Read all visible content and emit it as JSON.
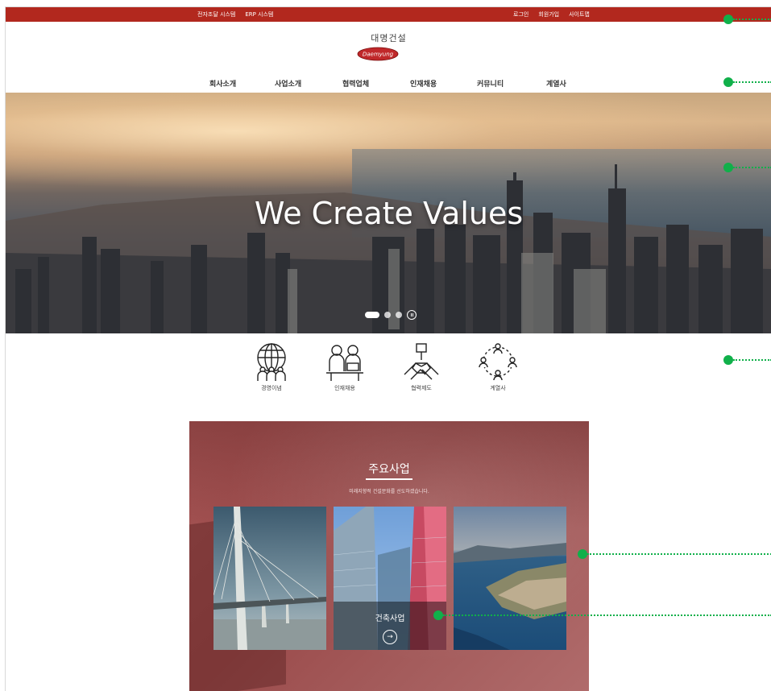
{
  "topbar": {
    "left_links": [
      "전자조달 시스템",
      "ERP 시스템"
    ],
    "right_links": [
      "로그인",
      "회원가입",
      "사이트맵"
    ]
  },
  "header": {
    "brand_name": "대명건설",
    "logo_text": "Daemyung"
  },
  "nav": {
    "items": [
      "회사소개",
      "사업소개",
      "협력업체",
      "인재채용",
      "커뮤니티",
      "계열사"
    ]
  },
  "hero": {
    "headline": "We Create Values",
    "slide_count": 3,
    "active_slide": 1
  },
  "quick_links": {
    "items": [
      {
        "label": "경영이념",
        "icon": "globe-people-icon"
      },
      {
        "label": "인재채용",
        "icon": "interview-icon"
      },
      {
        "label": "협력제도",
        "icon": "hands-together-icon"
      },
      {
        "label": "계열사",
        "icon": "network-people-icon"
      }
    ]
  },
  "business": {
    "title": "주요사업",
    "subtitle": "미래지향적 건설문화를 선도하겠습니다.",
    "cards": [
      {
        "name": "bridge",
        "caption": ""
      },
      {
        "name": "building",
        "caption": "건축사업"
      },
      {
        "name": "coast",
        "caption": ""
      }
    ]
  },
  "colors": {
    "topbar": "#b2281e",
    "accent_marker": "#10b04a",
    "business_bg": "#a65555"
  }
}
